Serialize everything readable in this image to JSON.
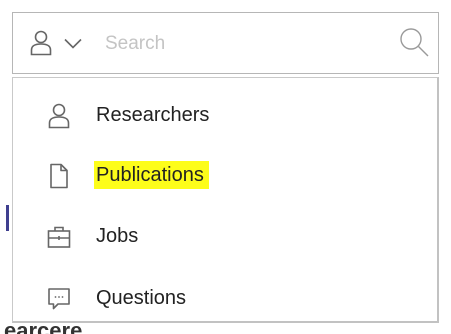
{
  "search": {
    "placeholder": "Search",
    "value": "",
    "scope_icon": "user-icon",
    "dropdown_icon": "chevron-down-icon",
    "submit_icon": "search-icon"
  },
  "menu": {
    "items": [
      {
        "label": "Researchers",
        "icon": "user-icon",
        "highlighted": false
      },
      {
        "label": "Publications",
        "icon": "document-icon",
        "highlighted": true
      },
      {
        "label": "Jobs",
        "icon": "briefcase-icon",
        "highlighted": false
      },
      {
        "label": "Questions",
        "icon": "chat-icon",
        "highlighted": false
      }
    ]
  },
  "background": {
    "partial_text": "earcere"
  },
  "colors": {
    "border": "#b6b6b6",
    "highlight": "#fdfd1a",
    "text": "#222222",
    "placeholder": "#c4c4c4",
    "icon": "#666666"
  }
}
